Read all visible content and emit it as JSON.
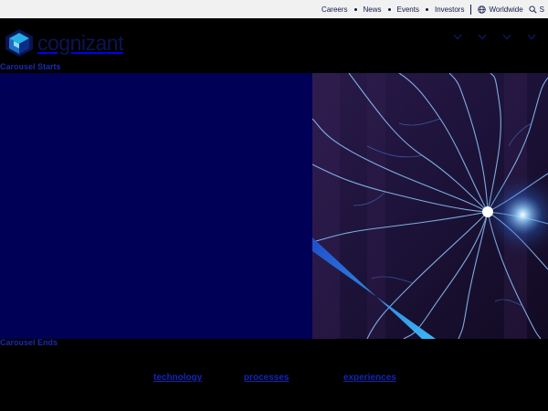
{
  "utility_nav": {
    "items": [
      "Careers",
      "News",
      "Events",
      "Investors"
    ],
    "region_label": "Worldwide",
    "search_label": "S"
  },
  "header": {
    "logo_text": "cognizant",
    "nav_items": [
      "",
      "",
      "",
      ""
    ]
  },
  "carousel": {
    "start_label": "Carousel Starts",
    "end_label": "Carousel Ends"
  },
  "keywords": [
    "technology",
    "processes",
    "experiences"
  ],
  "colors": {
    "utility_bg": "#f1f1f1",
    "navy_text": "#0f1a4d",
    "hero_bg": "#000057",
    "link_blue": "#1524b5",
    "page_bg": "#000000"
  }
}
